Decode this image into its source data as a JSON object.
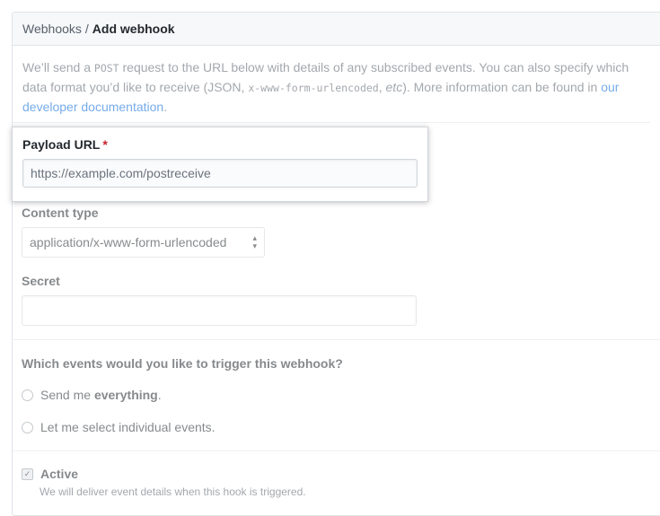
{
  "breadcrumb": {
    "parent": "Webhooks",
    "separator": "/",
    "current": "Add webhook"
  },
  "intro": {
    "t1": "We’ll send a ",
    "code1": "POST",
    "t2": " request to the URL below with details of any subscribed events. You can also specify which data format you’d like to receive (JSON, ",
    "code2": "x-www-form-urlencoded",
    "t3": ", ",
    "em": "etc",
    "t4": "). More information can be found in ",
    "link": "our developer documentation",
    "t5": "."
  },
  "payload": {
    "label": "Payload URL",
    "required_mark": "*",
    "value": "",
    "placeholder": "https://example.com/postreceive"
  },
  "content_type": {
    "label": "Content type",
    "selected": "application/x-www-form-urlencoded"
  },
  "secret": {
    "label": "Secret",
    "value": ""
  },
  "events": {
    "title": "Which events would you like to trigger this webhook?",
    "opt1_pre": "Send me ",
    "opt1_bold": "everything",
    "opt1_post": ".",
    "opt2": "Let me select individual events."
  },
  "active": {
    "label": "Active",
    "note": "We will deliver event details when this hook is triggered.",
    "checked": true
  },
  "icons": {
    "select_arrow": "select-arrows-icon",
    "check": "checkmark-icon"
  }
}
